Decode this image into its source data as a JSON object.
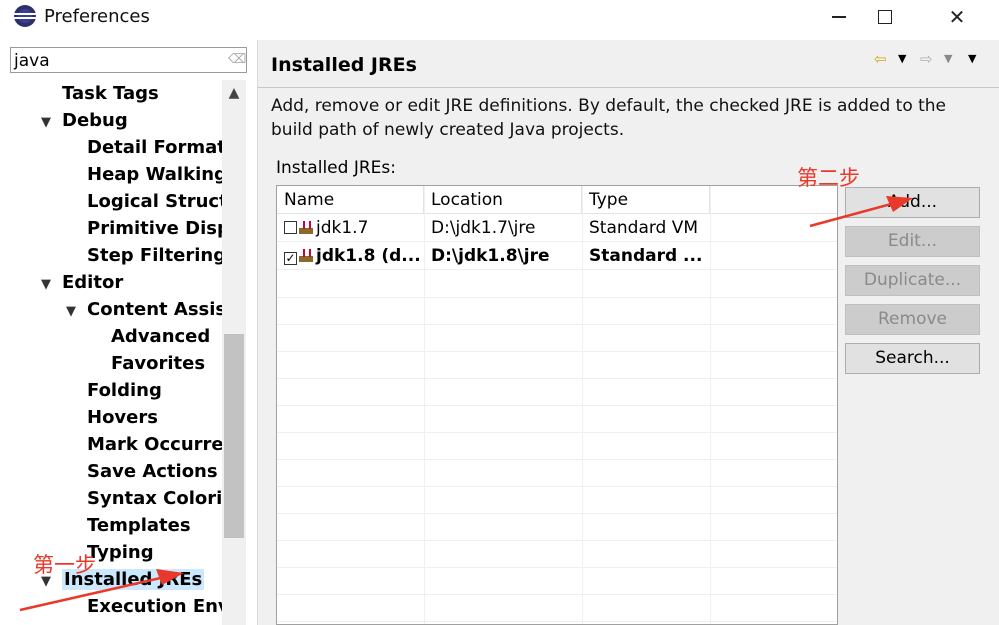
{
  "window": {
    "title": "Preferences",
    "controls": [
      "minimize",
      "maximize",
      "close"
    ]
  },
  "filter": {
    "value": "java"
  },
  "tree": {
    "items": [
      {
        "label": "Task Tags",
        "level": 2,
        "twisty": ""
      },
      {
        "label": "Debug",
        "level": 1,
        "twisty": "expanded"
      },
      {
        "label": "Detail Formatte",
        "level": 2,
        "twisty": ""
      },
      {
        "label": "Heap Walking",
        "level": 2,
        "twisty": ""
      },
      {
        "label": "Logical Structu",
        "level": 2,
        "twisty": ""
      },
      {
        "label": "Primitive Displa",
        "level": 2,
        "twisty": ""
      },
      {
        "label": "Step Filtering",
        "level": 2,
        "twisty": ""
      },
      {
        "label": "Editor",
        "level": 1,
        "twisty": "expanded"
      },
      {
        "label": "Content Assist",
        "level": 2,
        "twisty": "expanded"
      },
      {
        "label": "Advanced",
        "level": 3,
        "twisty": ""
      },
      {
        "label": "Favorites",
        "level": 3,
        "twisty": ""
      },
      {
        "label": "Folding",
        "level": 2,
        "twisty": ""
      },
      {
        "label": "Hovers",
        "level": 2,
        "twisty": ""
      },
      {
        "label": "Mark Occurren",
        "level": 2,
        "twisty": ""
      },
      {
        "label": "Save Actions",
        "level": 2,
        "twisty": ""
      },
      {
        "label": "Syntax Coloring",
        "level": 2,
        "twisty": ""
      },
      {
        "label": "Templates",
        "level": 2,
        "twisty": ""
      },
      {
        "label": "Typing",
        "level": 2,
        "twisty": ""
      },
      {
        "label": "Installed JREs",
        "level": 1,
        "twisty": "expanded",
        "selected": true
      },
      {
        "label": "Execution Envi",
        "level": 2,
        "twisty": ""
      }
    ]
  },
  "page": {
    "title": "Installed JREs",
    "description": "Add, remove or edit JRE definitions. By default, the checked JRE is added to the build path of newly created Java projects.",
    "table_label": "Installed JREs:"
  },
  "table": {
    "columns": [
      "Name",
      "Location",
      "Type"
    ],
    "rows": [
      {
        "checked": false,
        "name": "jdk1.7",
        "location": "D:\\jdk1.7\\jre",
        "type": "Standard VM",
        "bold": false
      },
      {
        "checked": true,
        "name": "jdk1.8 (d...",
        "location": "D:\\jdk1.8\\jre",
        "type": "Standard ...",
        "bold": true
      }
    ]
  },
  "buttons": {
    "add": "Add...",
    "edit": "Edit...",
    "duplicate": "Duplicate...",
    "remove": "Remove",
    "search": "Search..."
  },
  "annotations": {
    "step1": "第一步",
    "step2": "第二步",
    "color": "#e8392a"
  },
  "icons": {
    "app": "eclipse-icon",
    "back": "back-arrow-icon",
    "forward": "forward-arrow-icon",
    "dropdown": "triangle-down-icon"
  }
}
